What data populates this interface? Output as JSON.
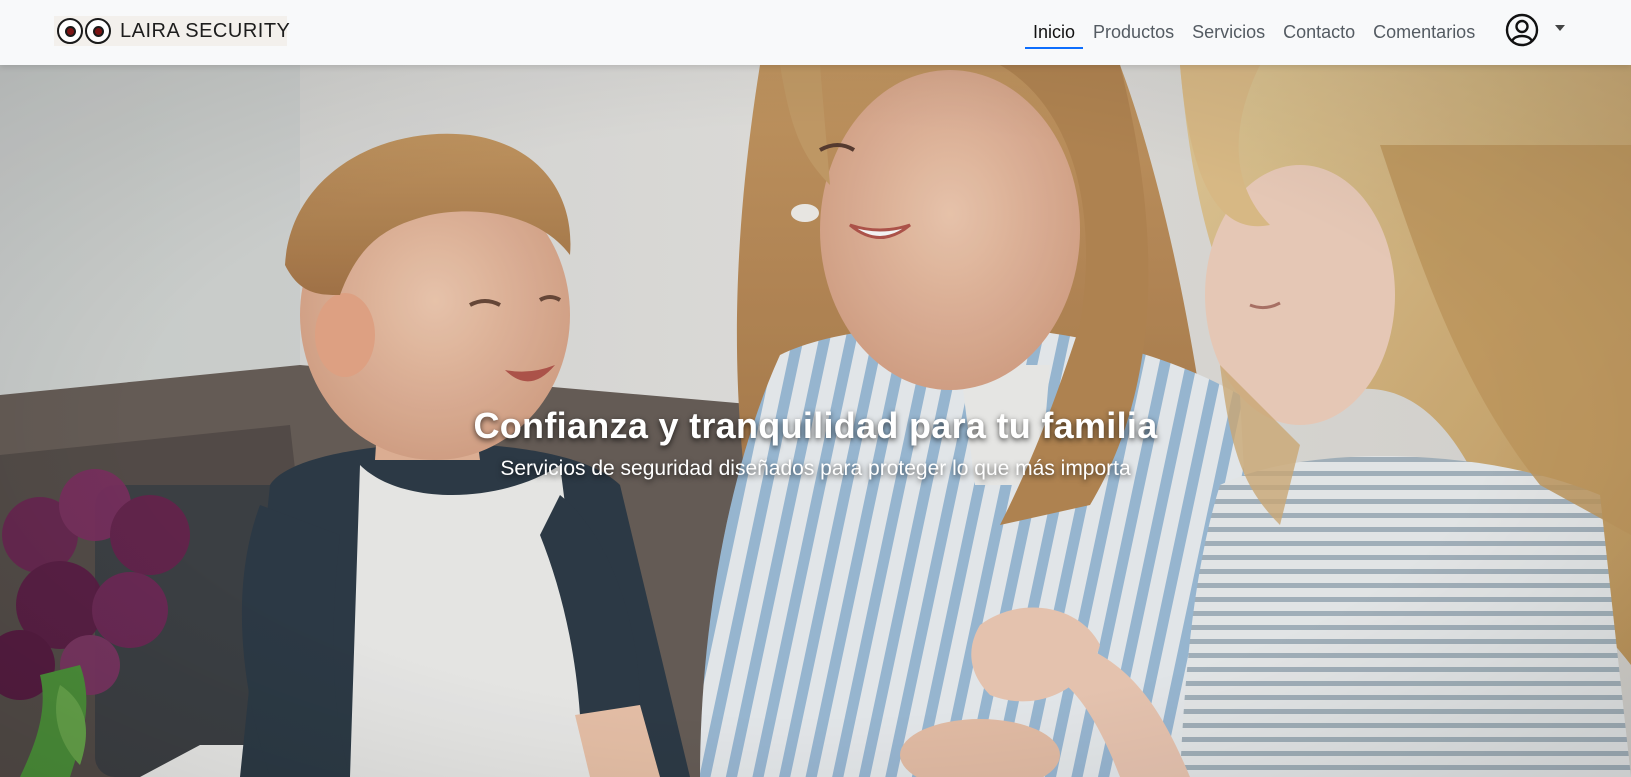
{
  "brand": {
    "name": "LAIRA SECURITY",
    "logo_icon": "eyes-logo-icon"
  },
  "nav": {
    "items": [
      {
        "label": "Inicio",
        "active": true
      },
      {
        "label": "Productos",
        "active": false
      },
      {
        "label": "Servicios",
        "active": false
      },
      {
        "label": "Contacto",
        "active": false
      },
      {
        "label": "Comentarios",
        "active": false
      }
    ],
    "user_icon": "user-circle-icon",
    "dropdown_icon": "caret-down-icon"
  },
  "hero": {
    "title": "Confianza y tranquilidad para tu familia",
    "subtitle": "Servicios de seguridad diseñados para proteger lo que más importa"
  },
  "colors": {
    "nav_bg": "#f8f9fa",
    "active_underline": "#0d6efd",
    "nav_text": "#545b62",
    "hero_text": "#ffffff"
  }
}
